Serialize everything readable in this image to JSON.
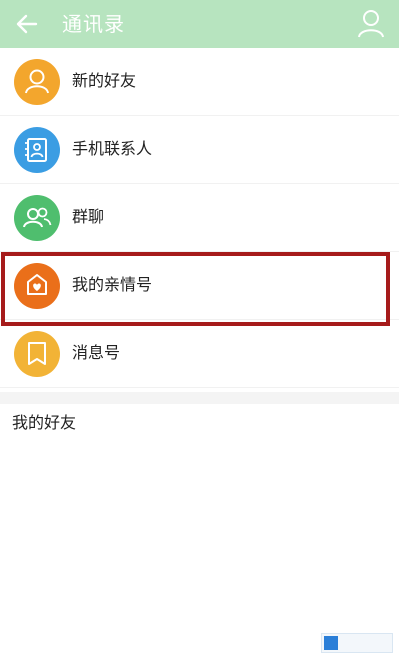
{
  "header": {
    "title": "通讯录",
    "back_icon": "back-arrow-icon",
    "profile_icon": "user-profile-icon",
    "background_color": "#b7e4bf"
  },
  "menu": {
    "items": [
      {
        "label": "新的好友",
        "icon": "new-friend-icon",
        "color": "#f3a62d"
      },
      {
        "label": "手机联系人",
        "icon": "phone-contacts-icon",
        "color": "#3b9de3"
      },
      {
        "label": "群聊",
        "icon": "group-chat-icon",
        "color": "#4fbe6e"
      },
      {
        "label": "我的亲情号",
        "icon": "family-number-icon",
        "color": "#ea6f1a"
      },
      {
        "label": "消息号",
        "icon": "message-account-icon",
        "color": "#f2b336"
      }
    ],
    "highlight_color": "#a61b1b"
  },
  "friends_section": {
    "title": "我的好友"
  }
}
